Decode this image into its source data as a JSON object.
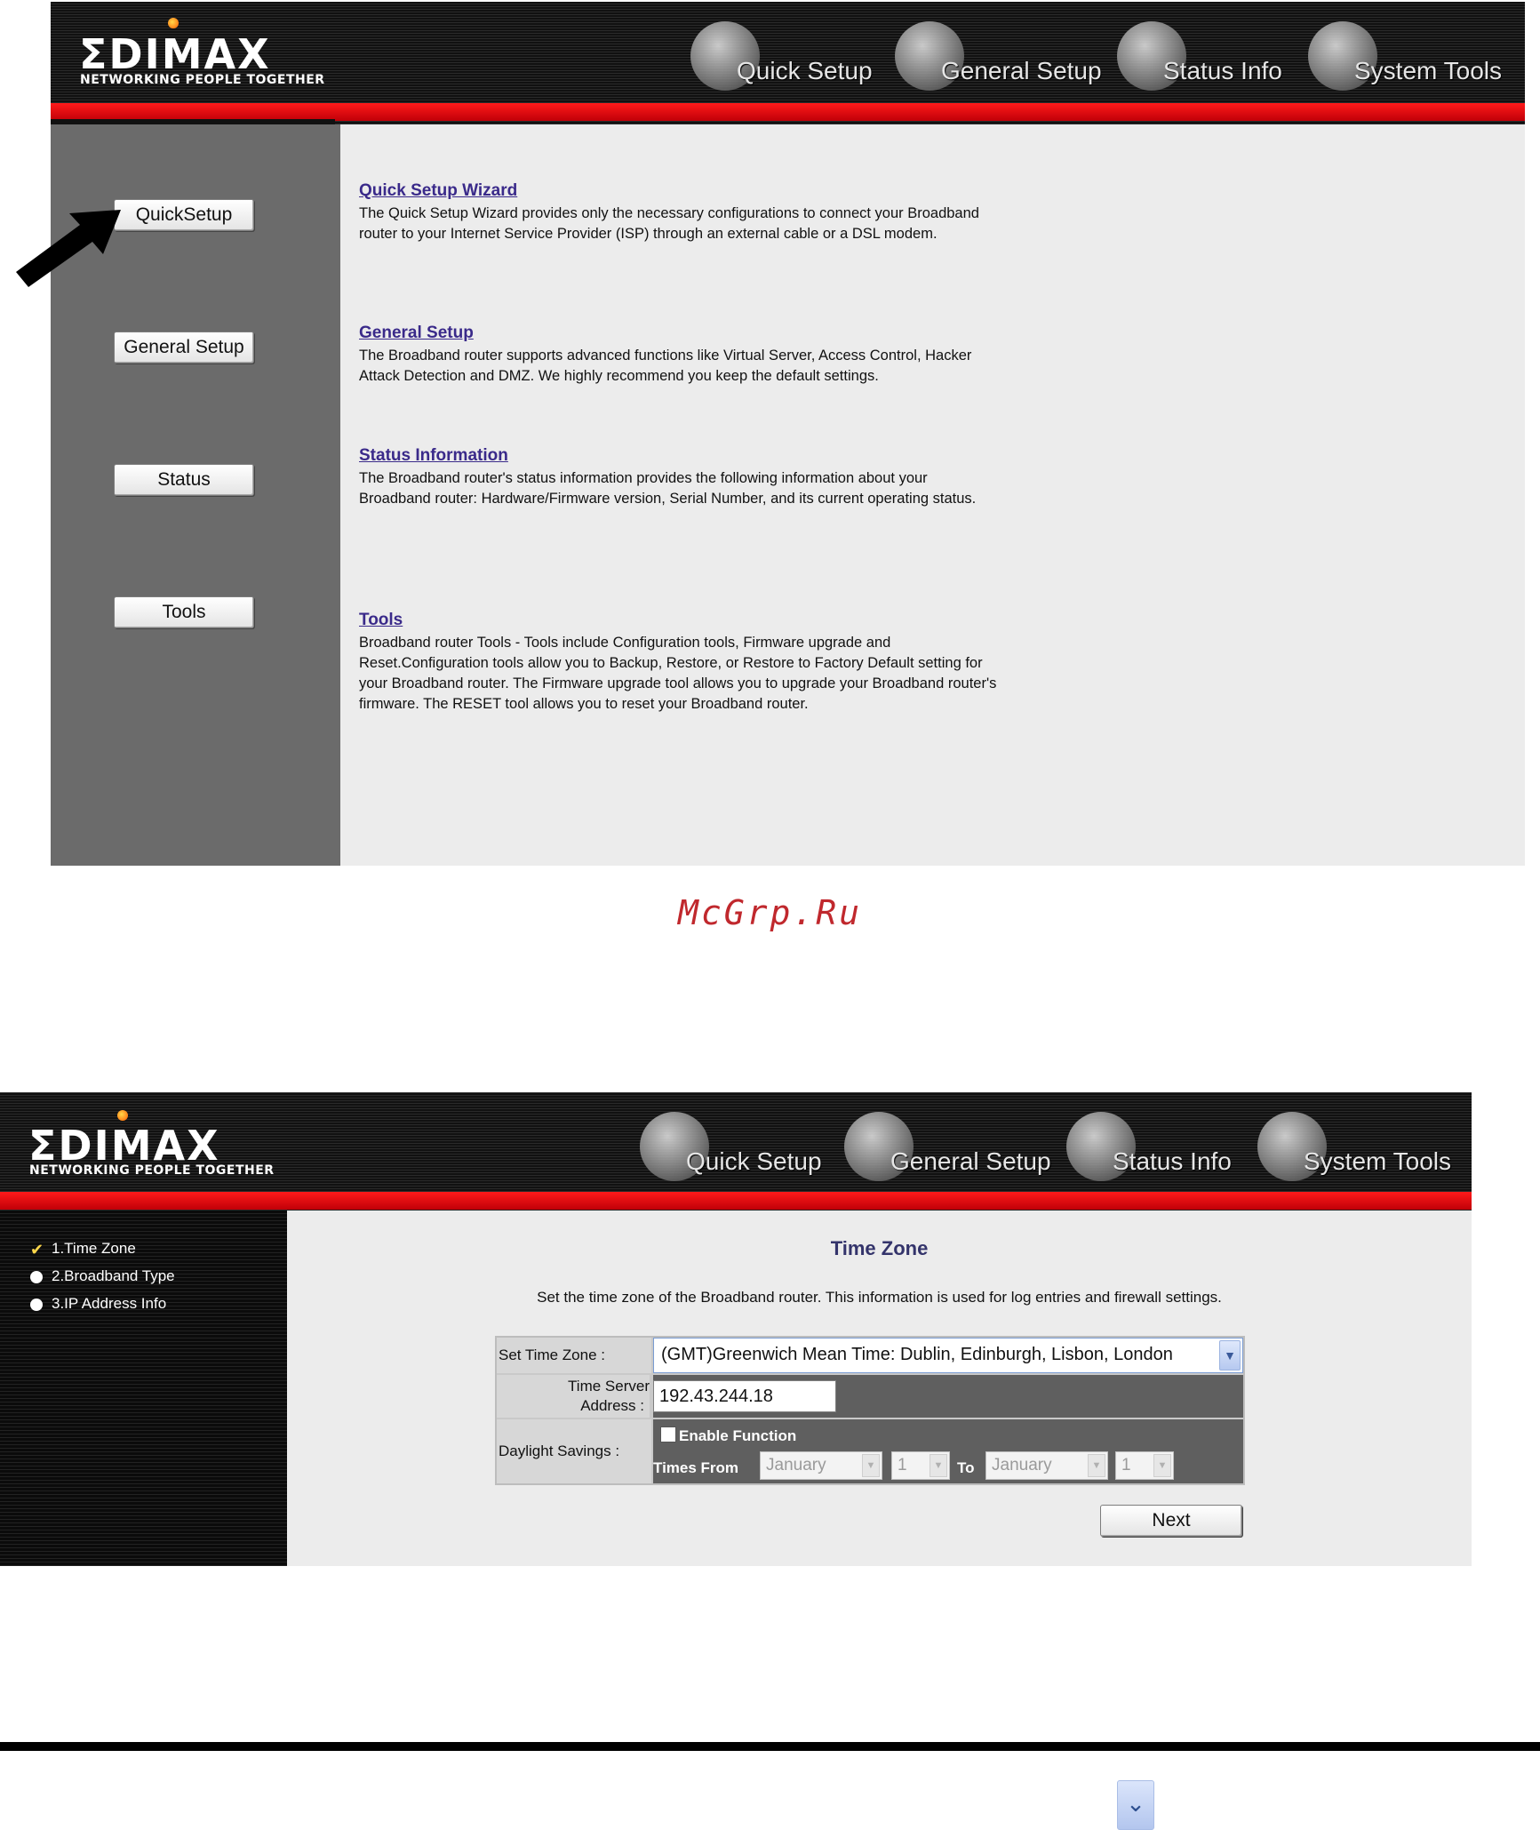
{
  "brand": {
    "logo": "ΣDIMAX",
    "tagline": "NETWORKING PEOPLE TOGETHER"
  },
  "top_nav": [
    {
      "label": "Quick Setup",
      "icon": "hand-globe-icon"
    },
    {
      "label": "General Setup",
      "icon": "cube-globe-icon"
    },
    {
      "label": "Status Info",
      "icon": "fax-globe-icon"
    },
    {
      "label": "System Tools",
      "icon": "tools-globe-icon"
    }
  ],
  "screen1": {
    "side_buttons": [
      "QuickSetup",
      "General Setup",
      "Status",
      "Tools"
    ],
    "sections": [
      {
        "title": "Quick Setup Wizard",
        "body": "The Quick Setup Wizard provides only the necessary configurations to connect your Broadband router to your Internet Service Provider (ISP) through an external cable or a DSL modem."
      },
      {
        "title": "General Setup",
        "body": "The Broadband router supports advanced functions like Virtual Server, Access Control, Hacker Attack Detection and DMZ. We highly recommend you keep the default settings."
      },
      {
        "title": "Status Information",
        "body": "The Broadband router's status information provides the following information about your Broadband router: Hardware/Firmware version, Serial Number, and its current operating status."
      },
      {
        "title": "Tools",
        "body": "Broadband router Tools - Tools include Configuration tools, Firmware upgrade and Reset.Configuration tools allow you to Backup, Restore, or Restore to Factory Default setting for your Broadband router. The Firmware upgrade tool allows you to upgrade your Broadband router's firmware. The RESET tool allows you to reset your Broadband router."
      }
    ]
  },
  "watermark": "McGrp.Ru",
  "screen2": {
    "steps": [
      {
        "label": "1.Time Zone",
        "state": "done"
      },
      {
        "label": "2.Broadband Type",
        "state": "pending"
      },
      {
        "label": "3.IP Address Info",
        "state": "pending"
      }
    ],
    "title": "Time Zone",
    "description": "Set the time zone of the Broadband router. This information is used for log entries and firewall settings.",
    "form": {
      "time_zone_label": "Set Time Zone :",
      "time_zone_value": "(GMT)Greenwich Mean Time: Dublin, Edinburgh, Lisbon, London",
      "time_server_label_1": "Time Server",
      "time_server_label_2": "Address :",
      "time_server_value": "192.43.244.18",
      "daylight_label": "Daylight Savings :",
      "enable_label": "Enable Function",
      "enable_checked": false,
      "times_from_label": "Times From",
      "to_label": "To",
      "from_month": "January",
      "from_day": "1",
      "to_month": "January",
      "to_day": "1"
    },
    "next_label": "Next"
  },
  "colors": {
    "red_bar": "#d9000d",
    "link_purple": "#3a2a8a",
    "watermark_red": "#c0282d"
  }
}
